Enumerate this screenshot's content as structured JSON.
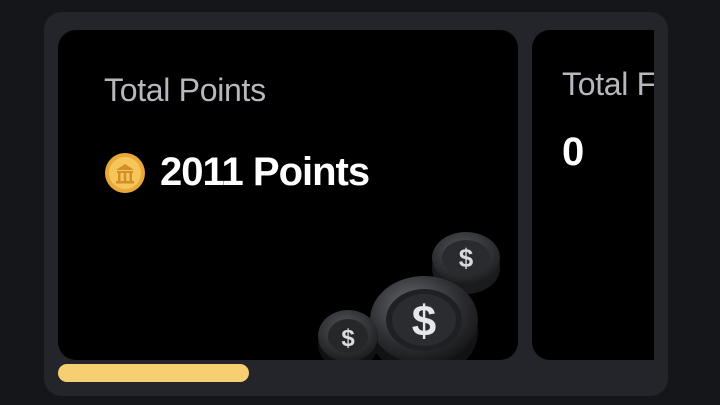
{
  "cards": [
    {
      "title": "Total Points",
      "value": "2011 Points",
      "icon": "coin-icon"
    },
    {
      "title": "Total F",
      "value": "0"
    }
  ],
  "scroll_progress": 0.32,
  "colors": {
    "accent": "#f6cf73",
    "card_bg": "#000000",
    "panel_bg": "#24252b",
    "page_bg": "#15161a"
  }
}
